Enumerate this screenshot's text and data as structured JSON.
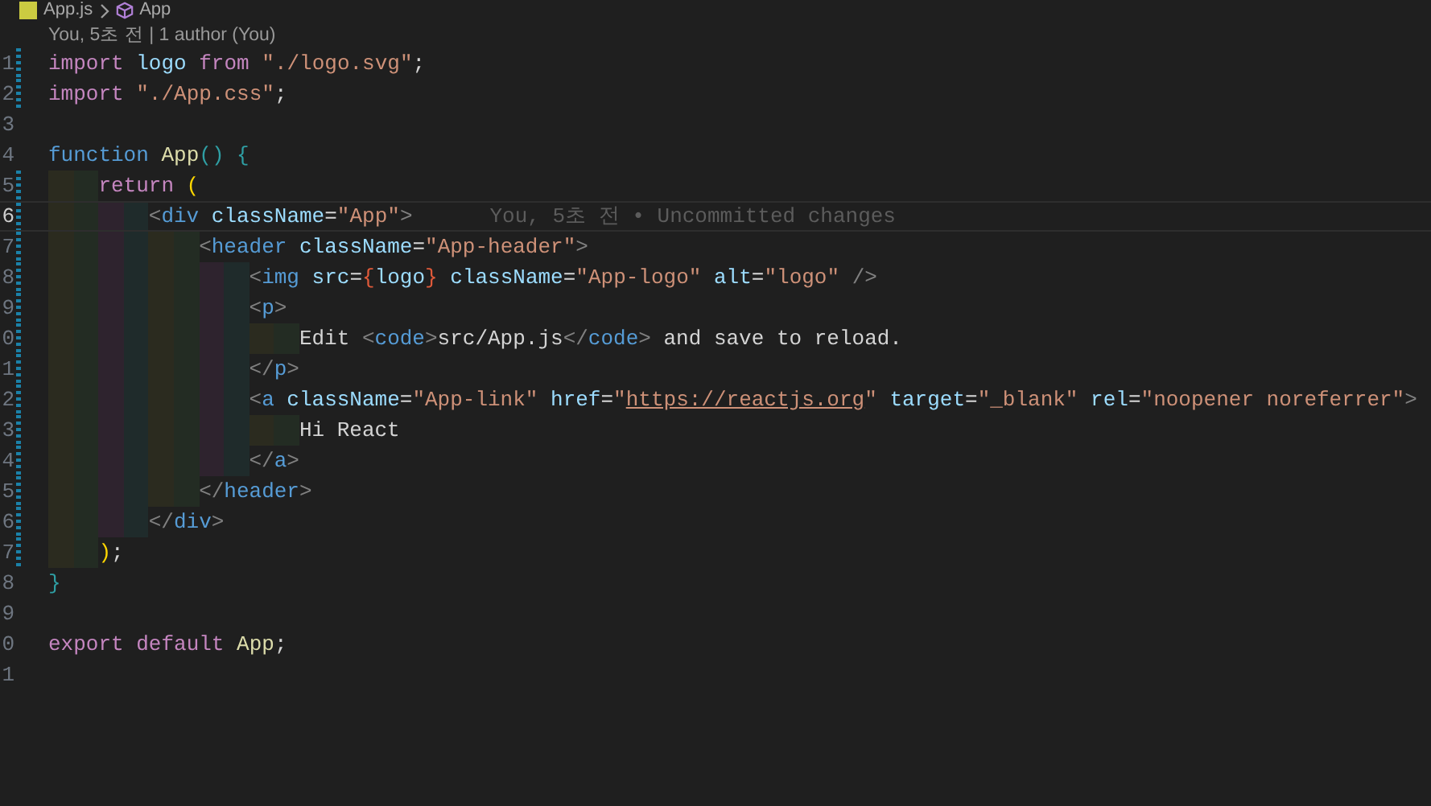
{
  "breadcrumb": [
    {
      "kind": "file",
      "text": "App.js"
    },
    {
      "kind": "symbol",
      "text": "App"
    }
  ],
  "codelens": "You, 5초 전 | 1 author (You)",
  "lines": [
    {
      "number": "1",
      "modified": true,
      "current": false,
      "tokens": [
        {
          "kind": "keyword",
          "text": "import"
        },
        {
          "kind": "variable",
          "text": " logo"
        },
        {
          "kind": "keyword",
          "text": " from"
        },
        {
          "kind": "string",
          "text": " \"./logo.svg\""
        },
        {
          "kind": "plain",
          "text": ";"
        }
      ]
    },
    {
      "number": "2",
      "modified": true,
      "current": false,
      "tokens": [
        {
          "kind": "keyword",
          "text": "import"
        },
        {
          "kind": "string",
          "text": " \"./App.css\""
        },
        {
          "kind": "plain",
          "text": ";"
        }
      ]
    },
    {
      "number": "3",
      "modified": false,
      "current": false
    },
    {
      "number": "4",
      "modified": false,
      "current": false,
      "tokens": [
        {
          "kind": "storage",
          "text": "function"
        },
        {
          "kind": "function",
          "text": " App"
        },
        {
          "kind": "bracket",
          "text": "()"
        },
        {
          "kind": "bracket",
          "text": " {"
        }
      ]
    },
    {
      "number": "5",
      "modified": true,
      "current": false,
      "indent_guides": [
        {
          "color": "#2b2b1f"
        },
        {
          "color": "#232c23"
        }
      ],
      "tokens": [
        {
          "kind": "keyword",
          "text": "return"
        },
        {
          "kind": "paren",
          "text": " ("
        }
      ]
    },
    {
      "number": "6",
      "modified": true,
      "current": true,
      "blame": "You, 5초 전 • Uncommitted changes",
      "indent_guides": [
        {
          "color": "#2b2b1f"
        },
        {
          "color": "#232c23"
        },
        {
          "color": "#2e232e"
        },
        {
          "color": "#1f2b2b"
        }
      ],
      "tokens": [
        {
          "kind": "punct",
          "text": "<"
        },
        {
          "kind": "tag",
          "text": "div"
        },
        {
          "kind": "attribute",
          "text": " className"
        },
        {
          "kind": "plain",
          "text": "="
        },
        {
          "kind": "string",
          "text": "\"App\""
        },
        {
          "kind": "punct",
          "text": ">"
        }
      ]
    },
    {
      "number": "7",
      "modified": true,
      "current": false,
      "indent_guides": [
        {
          "color": "#2b2b1f"
        },
        {
          "color": "#232c23"
        },
        {
          "color": "#2e232e"
        },
        {
          "color": "#1f2b2b"
        },
        {
          "color": "#2b2b1f"
        },
        {
          "color": "#232c23"
        }
      ],
      "tokens": [
        {
          "kind": "punct",
          "text": "<"
        },
        {
          "kind": "tag",
          "text": "header"
        },
        {
          "kind": "attribute",
          "text": " className"
        },
        {
          "kind": "plain",
          "text": "="
        },
        {
          "kind": "string",
          "text": "\"App-header\""
        },
        {
          "kind": "punct",
          "text": ">"
        }
      ]
    },
    {
      "number": "8",
      "modified": true,
      "current": false,
      "indent_guides": [
        {
          "color": "#2b2b1f"
        },
        {
          "color": "#232c23"
        },
        {
          "color": "#2e232e"
        },
        {
          "color": "#1f2b2b"
        },
        {
          "color": "#2b2b1f"
        },
        {
          "color": "#232c23"
        },
        {
          "color": "#2e232e"
        },
        {
          "color": "#1f2b2b"
        }
      ],
      "tokens": [
        {
          "kind": "punct",
          "text": "<"
        },
        {
          "kind": "tag",
          "text": "img"
        },
        {
          "kind": "attribute",
          "text": " src"
        },
        {
          "kind": "plain",
          "text": "="
        },
        {
          "kind": "brace",
          "text": "{"
        },
        {
          "kind": "variable",
          "text": "logo"
        },
        {
          "kind": "brace",
          "text": "}"
        },
        {
          "kind": "attribute",
          "text": " className"
        },
        {
          "kind": "plain",
          "text": "="
        },
        {
          "kind": "string",
          "text": "\"App-logo\""
        },
        {
          "kind": "attribute",
          "text": " alt"
        },
        {
          "kind": "plain",
          "text": "="
        },
        {
          "kind": "string",
          "text": "\"logo\""
        },
        {
          "kind": "punct",
          "text": " />"
        }
      ]
    },
    {
      "number": "9",
      "modified": true,
      "current": false,
      "indent_guides": [
        {
          "color": "#2b2b1f"
        },
        {
          "color": "#232c23"
        },
        {
          "color": "#2e232e"
        },
        {
          "color": "#1f2b2b"
        },
        {
          "color": "#2b2b1f"
        },
        {
          "color": "#232c23"
        },
        {
          "color": "#2e232e"
        },
        {
          "color": "#1f2b2b"
        }
      ],
      "tokens": [
        {
          "kind": "punct",
          "text": "<"
        },
        {
          "kind": "tag",
          "text": "p"
        },
        {
          "kind": "punct",
          "text": ">"
        }
      ]
    },
    {
      "number": "0",
      "modified": true,
      "current": false,
      "indent_guides": [
        {
          "color": "#2b2b1f"
        },
        {
          "color": "#232c23"
        },
        {
          "color": "#2e232e"
        },
        {
          "color": "#1f2b2b"
        },
        {
          "color": "#2b2b1f"
        },
        {
          "color": "#232c23"
        },
        {
          "color": "#2e232e"
        },
        {
          "color": "#1f2b2b"
        },
        {
          "color": "#2b2b1f"
        },
        {
          "color": "#232c23"
        }
      ],
      "tokens": [
        {
          "kind": "plain",
          "text": "Edit "
        },
        {
          "kind": "punct",
          "text": "<"
        },
        {
          "kind": "tag",
          "text": "code"
        },
        {
          "kind": "punct",
          "text": ">"
        },
        {
          "kind": "plain",
          "text": "src/App.js"
        },
        {
          "kind": "punct",
          "text": "</"
        },
        {
          "kind": "tag",
          "text": "code"
        },
        {
          "kind": "punct",
          "text": ">"
        },
        {
          "kind": "plain",
          "text": " and save to reload."
        }
      ]
    },
    {
      "number": "1",
      "modified": true,
      "current": false,
      "indent_guides": [
        {
          "color": "#2b2b1f"
        },
        {
          "color": "#232c23"
        },
        {
          "color": "#2e232e"
        },
        {
          "color": "#1f2b2b"
        },
        {
          "color": "#2b2b1f"
        },
        {
          "color": "#232c23"
        },
        {
          "color": "#2e232e"
        },
        {
          "color": "#1f2b2b"
        }
      ],
      "tokens": [
        {
          "kind": "punct",
          "text": "</"
        },
        {
          "kind": "tag",
          "text": "p"
        },
        {
          "kind": "punct",
          "text": ">"
        }
      ]
    },
    {
      "number": "2",
      "modified": true,
      "current": false,
      "indent_guides": [
        {
          "color": "#2b2b1f"
        },
        {
          "color": "#232c23"
        },
        {
          "color": "#2e232e"
        },
        {
          "color": "#1f2b2b"
        },
        {
          "color": "#2b2b1f"
        },
        {
          "color": "#232c23"
        },
        {
          "color": "#2e232e"
        },
        {
          "color": "#1f2b2b"
        }
      ],
      "tokens": [
        {
          "kind": "punct",
          "text": "<"
        },
        {
          "kind": "tag",
          "text": "a"
        },
        {
          "kind": "attribute",
          "text": " className"
        },
        {
          "kind": "plain",
          "text": "="
        },
        {
          "kind": "string",
          "text": "\"App-link\""
        },
        {
          "kind": "attribute",
          "text": " href"
        },
        {
          "kind": "plain",
          "text": "="
        },
        {
          "kind": "string",
          "text": "\""
        },
        {
          "kind": "link",
          "text": "https://reactjs.org"
        },
        {
          "kind": "string",
          "text": "\""
        },
        {
          "kind": "attribute",
          "text": " target"
        },
        {
          "kind": "plain",
          "text": "="
        },
        {
          "kind": "string",
          "text": "\"_blank\""
        },
        {
          "kind": "attribute",
          "text": " rel"
        },
        {
          "kind": "plain",
          "text": "="
        },
        {
          "kind": "string",
          "text": "\"noopener noreferrer\""
        },
        {
          "kind": "punct",
          "text": ">"
        }
      ]
    },
    {
      "number": "3",
      "modified": true,
      "current": false,
      "indent_guides": [
        {
          "color": "#2b2b1f"
        },
        {
          "color": "#232c23"
        },
        {
          "color": "#2e232e"
        },
        {
          "color": "#1f2b2b"
        },
        {
          "color": "#2b2b1f"
        },
        {
          "color": "#232c23"
        },
        {
          "color": "#2e232e"
        },
        {
          "color": "#1f2b2b"
        },
        {
          "color": "#2b2b1f"
        },
        {
          "color": "#232c23"
        }
      ],
      "tokens": [
        {
          "kind": "plain",
          "text": "Hi React"
        }
      ]
    },
    {
      "number": "4",
      "modified": true,
      "current": false,
      "indent_guides": [
        {
          "color": "#2b2b1f"
        },
        {
          "color": "#232c23"
        },
        {
          "color": "#2e232e"
        },
        {
          "color": "#1f2b2b"
        },
        {
          "color": "#2b2b1f"
        },
        {
          "color": "#232c23"
        },
        {
          "color": "#2e232e"
        },
        {
          "color": "#1f2b2b"
        }
      ],
      "tokens": [
        {
          "kind": "punct",
          "text": "</"
        },
        {
          "kind": "tag",
          "text": "a"
        },
        {
          "kind": "punct",
          "text": ">"
        }
      ]
    },
    {
      "number": "5",
      "modified": true,
      "current": false,
      "indent_guides": [
        {
          "color": "#2b2b1f"
        },
        {
          "color": "#232c23"
        },
        {
          "color": "#2e232e"
        },
        {
          "color": "#1f2b2b"
        },
        {
          "color": "#2b2b1f"
        },
        {
          "color": "#232c23"
        }
      ],
      "tokens": [
        {
          "kind": "punct",
          "text": "</"
        },
        {
          "kind": "tag",
          "text": "header"
        },
        {
          "kind": "punct",
          "text": ">"
        }
      ]
    },
    {
      "number": "6",
      "modified": true,
      "current": false,
      "indent_guides": [
        {
          "color": "#2b2b1f"
        },
        {
          "color": "#232c23"
        },
        {
          "color": "#2e232e"
        },
        {
          "color": "#1f2b2b"
        }
      ],
      "tokens": [
        {
          "kind": "punct",
          "text": "</"
        },
        {
          "kind": "tag",
          "text": "div"
        },
        {
          "kind": "punct",
          "text": ">"
        }
      ]
    },
    {
      "number": "7",
      "modified": true,
      "current": false,
      "indent_guides": [
        {
          "color": "#2b2b1f"
        },
        {
          "color": "#232c23"
        }
      ],
      "tokens": [
        {
          "kind": "paren",
          "text": ")"
        },
        {
          "kind": "plain",
          "text": ";"
        }
      ]
    },
    {
      "number": "8",
      "modified": false,
      "current": false,
      "tokens": [
        {
          "kind": "bracket",
          "text": "}"
        }
      ]
    },
    {
      "number": "9",
      "modified": false,
      "current": false
    },
    {
      "number": "0",
      "modified": false,
      "current": false,
      "tokens": [
        {
          "kind": "keyword",
          "text": "export"
        },
        {
          "kind": "keyword",
          "text": " default"
        },
        {
          "kind": "function",
          "text": " App"
        },
        {
          "kind": "plain",
          "text": ";"
        }
      ]
    },
    {
      "number": "1",
      "modified": false,
      "current": false
    }
  ]
}
